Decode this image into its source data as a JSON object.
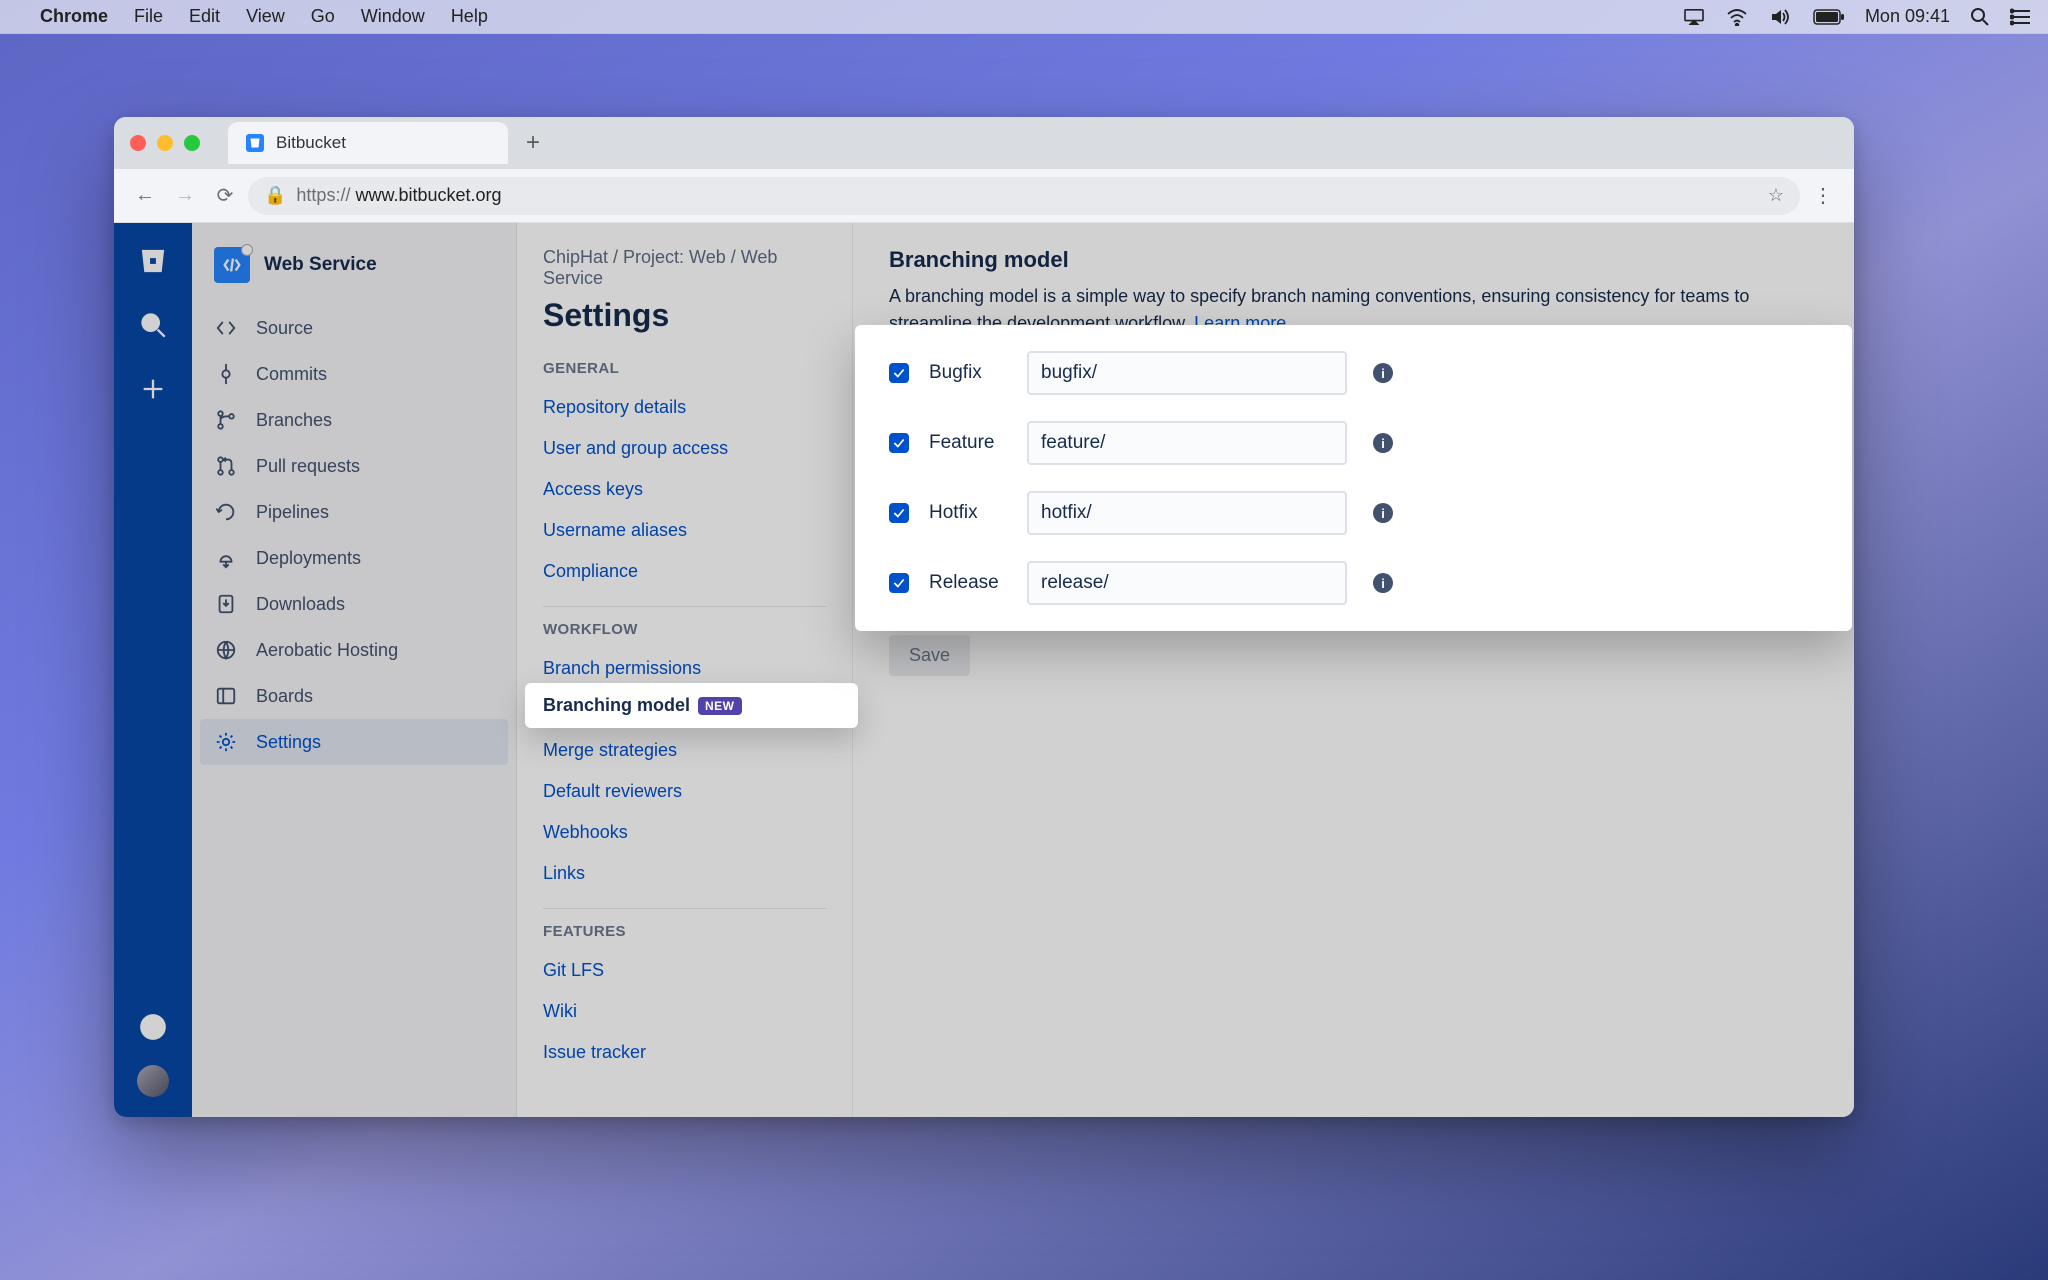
{
  "mac_menu": {
    "items": [
      "Chrome",
      "File",
      "Edit",
      "View",
      "Go",
      "Window",
      "Help"
    ],
    "clock": "Mon 09:41"
  },
  "browser": {
    "tab_title": "Bitbucket",
    "url_display": "https://www.bitbucket.org",
    "url_bold_part": "www.bitbucket.org",
    "url_prefix": "https://"
  },
  "project": {
    "name": "Web Service",
    "sidebar": [
      {
        "icon": "code",
        "label": "Source"
      },
      {
        "icon": "commit",
        "label": "Commits"
      },
      {
        "icon": "branch",
        "label": "Branches"
      },
      {
        "icon": "pr",
        "label": "Pull requests"
      },
      {
        "icon": "pipe",
        "label": "Pipelines"
      },
      {
        "icon": "deploy",
        "label": "Deployments"
      },
      {
        "icon": "dl",
        "label": "Downloads"
      },
      {
        "icon": "aero",
        "label": "Aerobatic Hosting"
      },
      {
        "icon": "boards",
        "label": "Boards"
      },
      {
        "icon": "gear",
        "label": "Settings"
      }
    ],
    "active_sidebar_index": 9
  },
  "breadcrumb": "ChipHat / Project: Web / Web Service",
  "page_title": "Settings",
  "settings_nav": {
    "general_label": "GENERAL",
    "general": [
      "Repository details",
      "User and group access",
      "Access keys",
      "Username aliases",
      "Compliance"
    ],
    "workflow_label": "WORKFLOW",
    "workflow": [
      "Branch permissions",
      "Branching model",
      "Merge strategies",
      "Default reviewers",
      "Webhooks",
      "Links"
    ],
    "workflow_current_index": 1,
    "workflow_new_badge": "NEW",
    "features_label": "FEATURES",
    "features": [
      "Git LFS",
      "Wiki",
      "Issue tracker"
    ]
  },
  "config": {
    "title": "Branching model",
    "desc": "A branching model is a simple way to specify branch naming conventions, ensuring consistency for teams to streamline the development workflow.",
    "learn_more": "Learn more",
    "rows": [
      {
        "label": "Bugfix",
        "value": "bugfix/"
      },
      {
        "label": "Feature",
        "value": "feature/"
      },
      {
        "label": "Hotfix",
        "value": "hotfix/"
      },
      {
        "label": "Release",
        "value": "release/"
      }
    ],
    "save_label": "Save"
  }
}
